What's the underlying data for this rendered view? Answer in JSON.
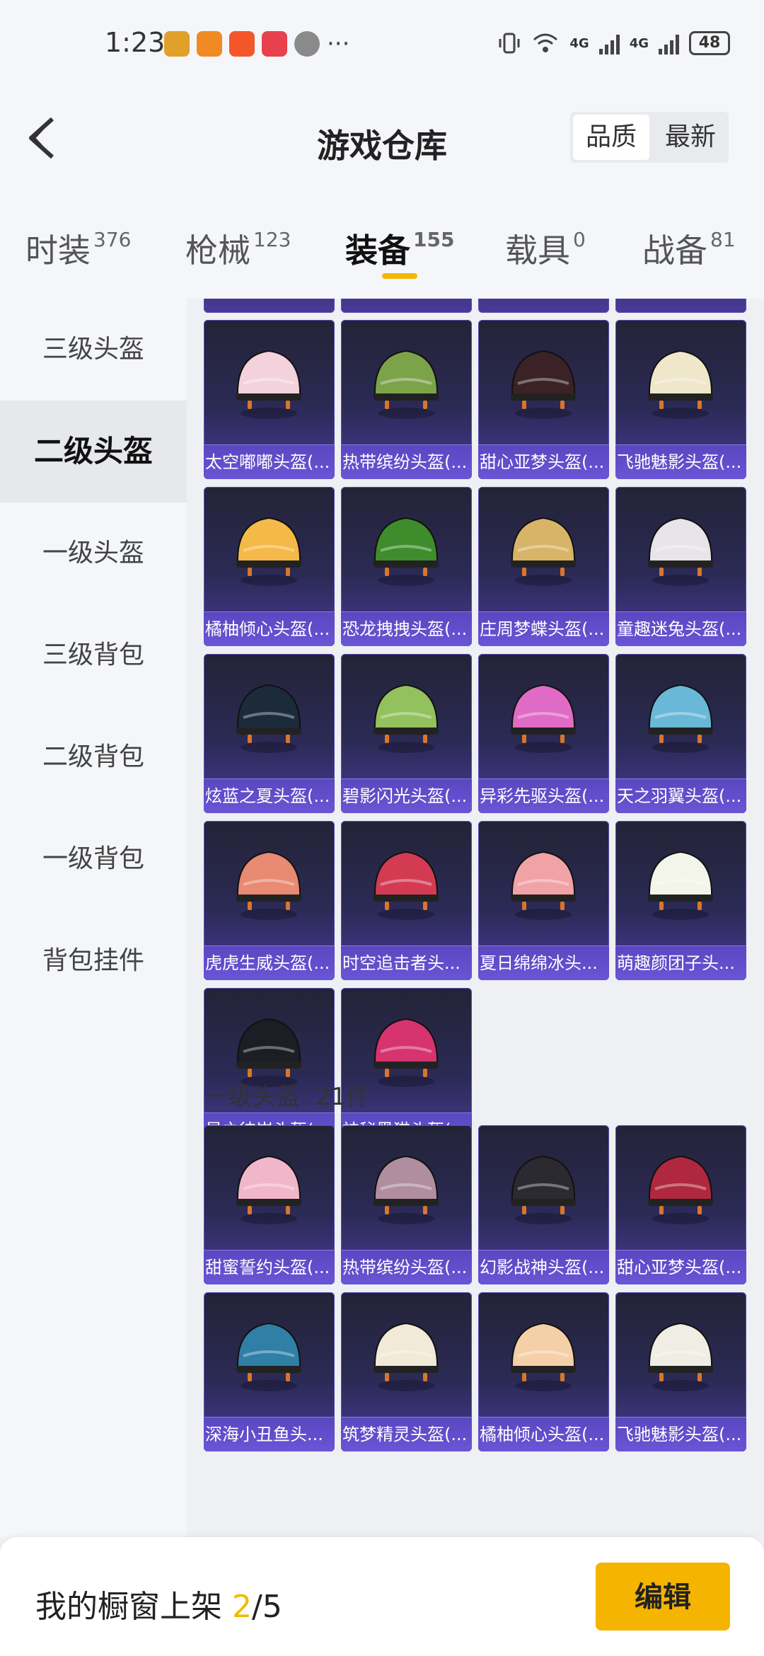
{
  "status_bar": {
    "time": "1:23",
    "battery": "48",
    "network1": "4G",
    "network2": "4G",
    "more": "···"
  },
  "header": {
    "title": "游戏仓库",
    "sort_quality": "品质",
    "sort_newest": "最新"
  },
  "tabs": [
    {
      "label": "时装",
      "count": "376"
    },
    {
      "label": "枪械",
      "count": "123"
    },
    {
      "label": "装备",
      "count": "155"
    },
    {
      "label": "载具",
      "count": "0"
    },
    {
      "label": "战备",
      "count": "81"
    }
  ],
  "sidebar": [
    "三级头盔",
    "二级头盔",
    "一级头盔",
    "三级背包",
    "二级背包",
    "一级背包",
    "背包挂件"
  ],
  "level2_items": [
    {
      "name": "太空嘟嘟头盔(...",
      "color": "#f3d2dc"
    },
    {
      "name": "热带缤纷头盔(...",
      "color": "#7ba34a"
    },
    {
      "name": "甜心亚梦头盔(...",
      "color": "#3a2226"
    },
    {
      "name": "飞驰魅影头盔(...",
      "color": "#efe7c9"
    },
    {
      "name": "橘柚倾心头盔(...",
      "color": "#f4b948"
    },
    {
      "name": "恐龙拽拽头盔(...",
      "color": "#3e8c2c"
    },
    {
      "name": "庄周梦蝶头盔(...",
      "color": "#d8b468"
    },
    {
      "name": "童趣迷兔头盔(...",
      "color": "#e9e3ea"
    },
    {
      "name": "炫蓝之夏头盔(...",
      "color": "#1c2b3a"
    },
    {
      "name": "碧影闪光头盔(...",
      "color": "#93c15d"
    },
    {
      "name": "异彩先驱头盔(...",
      "color": "#e06bc7"
    },
    {
      "name": "天之羽翼头盔(...",
      "color": "#6ab8d8"
    },
    {
      "name": "虎虎生威头盔(...",
      "color": "#e98a72"
    },
    {
      "name": "时空追击者头...",
      "color": "#d33b53"
    },
    {
      "name": "夏日绵绵冰头...",
      "color": "#f1a2a6"
    },
    {
      "name": "萌趣颜团子头...",
      "color": "#f3f5ea"
    },
    {
      "name": "星之彼岸头盔(...",
      "color": "#1d1d26"
    },
    {
      "name": "神秘黑猫头盔(...",
      "color": "#d6336f"
    }
  ],
  "level1_title": "一级头盔: 21件",
  "level1_items": [
    {
      "name": "甜蜜誓约头盔(...",
      "color": "#f2b6cb"
    },
    {
      "name": "热带缤纷头盔(...",
      "color": "#b08e9f"
    },
    {
      "name": "幻影战神头盔(...",
      "color": "#2b2a30"
    },
    {
      "name": "甜心亚梦头盔(...",
      "color": "#b0283e"
    },
    {
      "name": "深海小丑鱼头...",
      "color": "#2f7fa6"
    },
    {
      "name": "筑梦精灵头盔(...",
      "color": "#f1ead8"
    },
    {
      "name": "橘柚倾心头盔(...",
      "color": "#f4cfa8"
    },
    {
      "name": "飞驰魅影头盔(...",
      "color": "#f0ede4"
    }
  ],
  "bottom": {
    "label": "我的橱窗上架 ",
    "current": "2",
    "total": "/5",
    "edit": "编辑"
  },
  "colors": {
    "accent": "#f5b400",
    "tile_bg": "#2b2a55",
    "tile_label": "#5a47c0"
  }
}
